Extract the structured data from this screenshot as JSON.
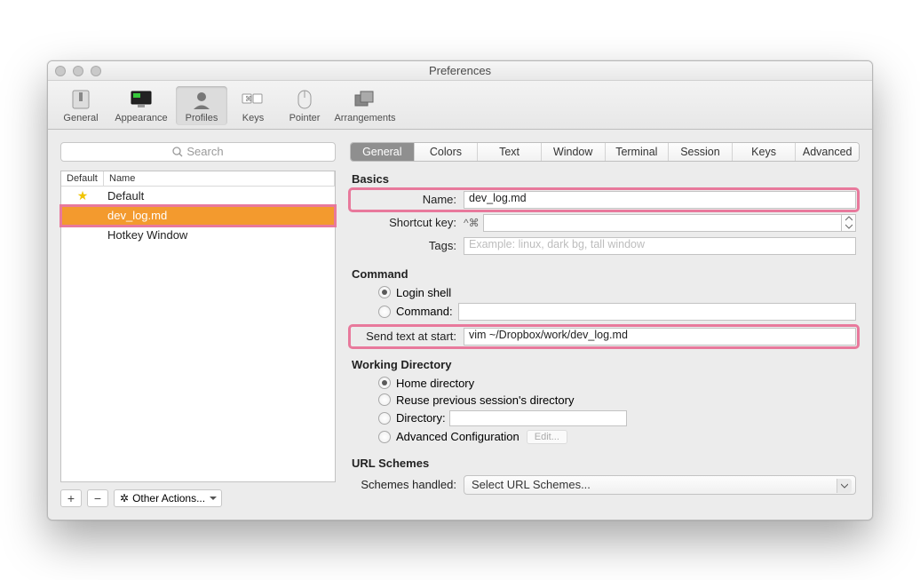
{
  "window": {
    "title": "Preferences"
  },
  "toolbar": {
    "items": [
      {
        "label": "General"
      },
      {
        "label": "Appearance"
      },
      {
        "label": "Profiles"
      },
      {
        "label": "Keys"
      },
      {
        "label": "Pointer"
      },
      {
        "label": "Arrangements"
      }
    ]
  },
  "search": {
    "placeholder": "Search"
  },
  "profile_list": {
    "columns": {
      "default": "Default",
      "name": "Name"
    },
    "rows": [
      {
        "default": true,
        "name": "Default",
        "selected": false
      },
      {
        "default": false,
        "name": "dev_log.md",
        "selected": true
      },
      {
        "default": false,
        "name": "Hotkey Window",
        "selected": false
      }
    ]
  },
  "left_actions": {
    "add": "+",
    "remove": "−",
    "other": "Other Actions..."
  },
  "tabs": [
    "General",
    "Colors",
    "Text",
    "Window",
    "Terminal",
    "Session",
    "Keys",
    "Advanced"
  ],
  "active_tab": "General",
  "basics": {
    "heading": "Basics",
    "name_label": "Name:",
    "name_value": "dev_log.md",
    "shortcut_label": "Shortcut key:",
    "shortcut_keys": "^⌘",
    "tags_label": "Tags:",
    "tags_placeholder": "Example: linux, dark bg, tall window"
  },
  "command": {
    "heading": "Command",
    "login_shell": "Login shell",
    "command_label": "Command:",
    "send_label": "Send text at start:",
    "send_value": "vim ~/Dropbox/work/dev_log.md"
  },
  "working_dir": {
    "heading": "Working Directory",
    "home": "Home directory",
    "reuse": "Reuse previous session's directory",
    "directory": "Directory:",
    "advanced": "Advanced Configuration",
    "edit": "Edit..."
  },
  "url_schemes": {
    "heading": "URL Schemes",
    "label": "Schemes handled:",
    "value": "Select URL Schemes..."
  }
}
